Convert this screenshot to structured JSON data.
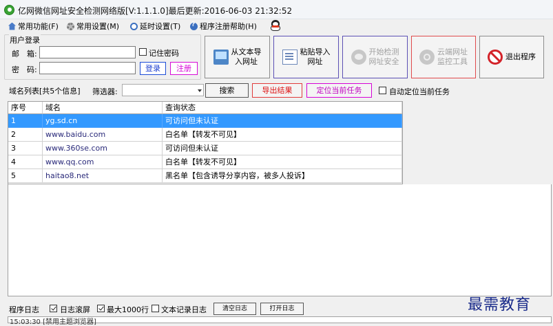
{
  "window": {
    "title": "亿网微信网址安全检测网络版[V:1.1.1.0]最后更新:2016-06-03 21:32:52"
  },
  "menu": [
    {
      "label": "常用功能(F)",
      "icon": "home-icon"
    },
    {
      "label": "常用设置(M)",
      "icon": "gear-icon"
    },
    {
      "label": "延时设置(T)",
      "icon": "clock-icon"
    },
    {
      "label": "程序注册帮助(H)",
      "icon": "help-icon"
    }
  ],
  "login": {
    "group_title": "用户登录",
    "email_label": "邮　箱:",
    "email_value": "",
    "password_label": "密　码:",
    "password_value": "",
    "remember_label": "记住密码",
    "remember_checked": false,
    "login_label": "登录",
    "register_label": "注册"
  },
  "toolbar": {
    "import_text": "从文本导\n入网址",
    "paste_import": "粘贴导入\n网址",
    "start_check": "开始检测\n网址安全",
    "cloud_monitor": "云端网址\n监控工具",
    "exit": "退出程序"
  },
  "filter": {
    "domain_list_label": "域名列表[共5个信息]",
    "filter_label": "筛选器:",
    "filter_value": "",
    "search_label": "搜索",
    "export_label": "导出结果",
    "locate_label": "定位当前任务",
    "auto_locate_label": "自动定位当前任务",
    "auto_locate_checked": false
  },
  "table": {
    "columns": [
      "序号",
      "域名",
      "查询状态"
    ],
    "rows": [
      {
        "index": "1",
        "domain": "yg.sd.cn",
        "status": "可访问但未认证",
        "selected": true
      },
      {
        "index": "2",
        "domain": "www.baidu.com",
        "status": "白名单【转发不可见】",
        "selected": false
      },
      {
        "index": "3",
        "domain": "www.360se.com",
        "status": "可访问但未认证",
        "selected": false
      },
      {
        "index": "4",
        "domain": "www.qq.com",
        "status": "白名单【转发不可见】",
        "selected": false
      },
      {
        "index": "5",
        "domain": "haitao8.net",
        "status": "黑名单【包含诱导分享内容，被多人投诉】",
        "selected": false
      }
    ]
  },
  "log": {
    "label": "程序日志",
    "scroll_label": "日志滚屏",
    "scroll_checked": true,
    "max_label": "最大1000行",
    "max_checked": true,
    "text_log_label": "文本记录日志",
    "text_log_checked": false,
    "clear_label": "清空日志",
    "open_label": "打开日志",
    "first_line": "15:03:30 [禁用主题浏览器]"
  },
  "watermark": "最需教育",
  "colors": {
    "selection": "#3399ff",
    "login_border": "#1b4bd6",
    "register_border": "#d60ad6",
    "export_border": "#e03a3a",
    "watermark": "#1a2b8a"
  }
}
